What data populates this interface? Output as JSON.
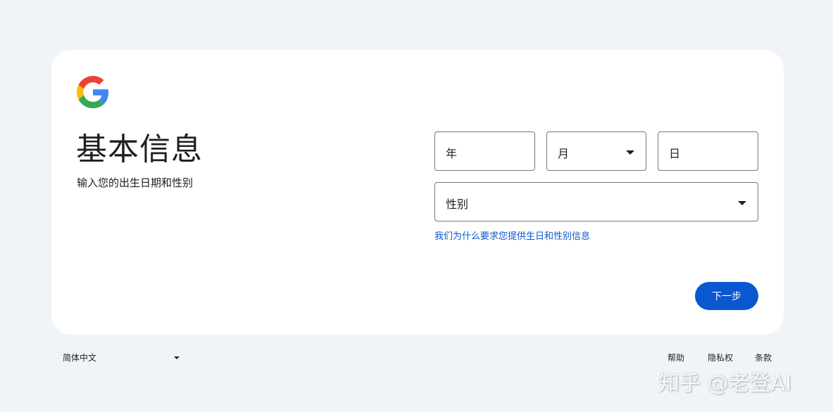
{
  "page": {
    "title": "基本信息",
    "subtitle": "输入您的出生日期和性别"
  },
  "form": {
    "year_label": "年",
    "month_label": "月",
    "day_label": "日",
    "gender_label": "性别",
    "why_link": "我们为什么要求您提供生日和性别信息",
    "next_button": "下一步"
  },
  "footer": {
    "language": "简体中文",
    "help": "帮助",
    "privacy": "隐私权",
    "terms": "条款"
  },
  "watermark": "知乎 @老登AI",
  "colors": {
    "background": "#f0f4f9",
    "card": "#ffffff",
    "primary": "#0b57d0",
    "text": "#1f1f1f",
    "border": "#747775"
  },
  "icons": [
    "google-logo",
    "chevron-down-icon"
  ]
}
